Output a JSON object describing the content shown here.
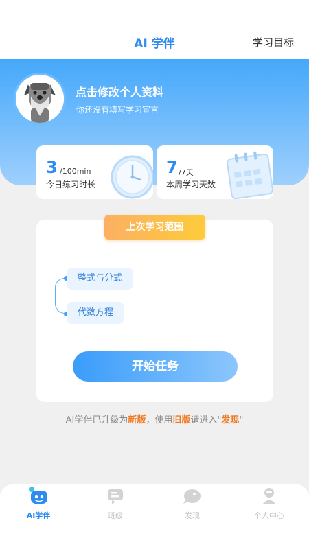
{
  "header": {
    "title": "AI 学伴",
    "right_link": "学习目标"
  },
  "profile": {
    "title": "点击修改个人资料",
    "subtitle": "你还没有填写学习宣言"
  },
  "stats": [
    {
      "value": "3",
      "unit": "/100min",
      "label": "今日练习时长",
      "icon": "clock-icon"
    },
    {
      "value": "7",
      "unit": "/7天",
      "label": "本周学习天数",
      "icon": "calendar-icon"
    }
  ],
  "last_range": {
    "tag": "上次学习范围",
    "topics": [
      "整式与分式",
      "代数方程"
    ],
    "start_button": "开始任务"
  },
  "notice": {
    "p1": "AI学伴已升级为",
    "h1": "新版",
    "p2": "，使用",
    "h2": "旧版",
    "p3": "请进入\"",
    "h3": "发现",
    "p4": "\""
  },
  "tabs": [
    {
      "label": "AI学伴",
      "icon": "robot-icon",
      "active": true
    },
    {
      "label": "班级",
      "icon": "class-icon",
      "active": false
    },
    {
      "label": "发现",
      "icon": "discover-icon",
      "active": false
    },
    {
      "label": "个人中心",
      "icon": "person-icon",
      "active": false
    }
  ],
  "colors": {
    "accent": "#2e8bf0",
    "highlight": "#f07a20",
    "tag": "#fcb063"
  }
}
